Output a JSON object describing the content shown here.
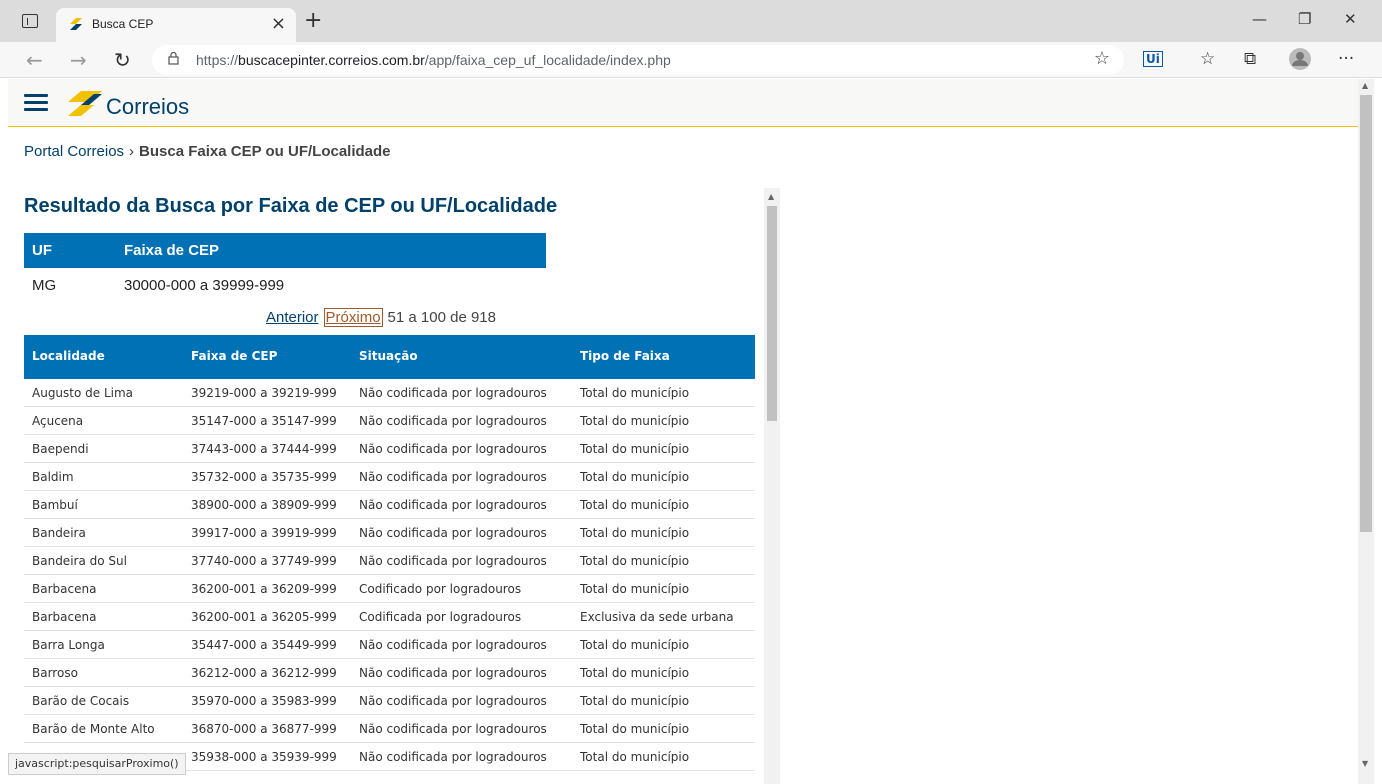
{
  "browser": {
    "tab_title": "Busca CEP",
    "url_prefix": "https://",
    "url_host": "buscacepinter.correios.com.br",
    "url_path": "/app/faixa_cep_uf_localidade/index.php"
  },
  "site": {
    "logo_text": "Correios",
    "brand_colors": {
      "blue": "#00416b",
      "yellow": "#f2c200",
      "table_header": "#0071b4"
    }
  },
  "breadcrumb": {
    "home": "Portal Correios",
    "separator": "›",
    "current": "Busca Faixa CEP ou UF/Localidade"
  },
  "page_title": "Resultado da Busca por Faixa de CEP ou UF/Localidade",
  "uf_table": {
    "headers": [
      "UF",
      "Faixa de CEP"
    ],
    "row": [
      "MG",
      "30000-000 a 39999-999"
    ]
  },
  "pager": {
    "prev": "Anterior",
    "next": "Próximo",
    "info": "51 a 100 de 918"
  },
  "results": {
    "headers": [
      "Localidade",
      "Faixa de CEP",
      "Situação",
      "Tipo de Faixa"
    ],
    "rows": [
      [
        "Augusto de Lima",
        "39219-000 a 39219-999",
        "Não codificada por logradouros",
        "Total do município"
      ],
      [
        "Açucena",
        "35147-000 a 35147-999",
        "Não codificada por logradouros",
        "Total do município"
      ],
      [
        "Baependi",
        "37443-000 a 37444-999",
        "Não codificada por logradouros",
        "Total do município"
      ],
      [
        "Baldim",
        "35732-000 a 35735-999",
        "Não codificada por logradouros",
        "Total do município"
      ],
      [
        "Bambuí",
        "38900-000 a 38909-999",
        "Não codificada por logradouros",
        "Total do município"
      ],
      [
        "Bandeira",
        "39917-000 a 39919-999",
        "Não codificada por logradouros",
        "Total do município"
      ],
      [
        "Bandeira do Sul",
        "37740-000 a 37749-999",
        "Não codificada por logradouros",
        "Total do município"
      ],
      [
        "Barbacena",
        "36200-001 a 36209-999",
        "Codificado por logradouros",
        "Total do município"
      ],
      [
        "Barbacena",
        "36200-001 a 36205-999",
        "Codificada por logradouros",
        "Exclusiva da sede urbana"
      ],
      [
        "Barra Longa",
        "35447-000 a 35449-999",
        "Não codificada por logradouros",
        "Total do município"
      ],
      [
        "Barroso",
        "36212-000 a 36212-999",
        "Não codificada por logradouros",
        "Total do município"
      ],
      [
        "Barão de Cocais",
        "35970-000 a 35983-999",
        "Não codificada por logradouros",
        "Total do município"
      ],
      [
        "Barão de Monte Alto",
        "36870-000 a 36877-999",
        "Não codificada por logradouros",
        "Total do município"
      ],
      [
        "",
        "35938-000 a 35939-999",
        "Não codificada por logradouros",
        "Total do município"
      ]
    ]
  },
  "status_bar": "javascript:pesquisarProximo()"
}
